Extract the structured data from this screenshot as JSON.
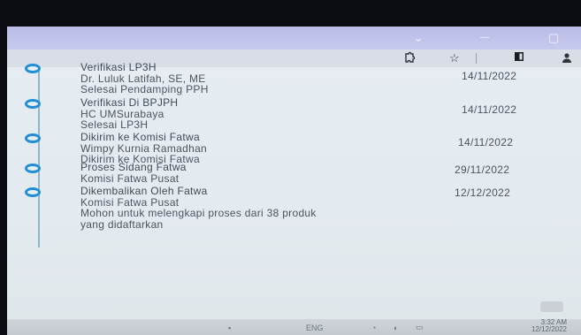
{
  "window": {
    "min_icon": "⌄",
    "dash_icon": "—",
    "restore_icon": "▢"
  },
  "toolbar": {
    "extension_icon": "puzzle-icon",
    "star_icon": "star-icon",
    "split_icon": "split-view-icon",
    "profile_icon": "profile-icon"
  },
  "timeline": [
    {
      "lines": [
        "Verifikasi LP3H",
        "Dr. Luluk Latifah, SE, ME",
        "Selesai Pendamping PPH"
      ],
      "date": "14/11/2022"
    },
    {
      "lines": [
        "Verifikasi Di BPJPH",
        "HC UMSurabaya",
        "Selesai LP3H"
      ],
      "date": "14/11/2022"
    },
    {
      "lines": [
        "Dikirim ke Komisi Fatwa",
        "Wimpy Kurnia Ramadhan",
        "Dikirim ke Komisi Fatwa"
      ],
      "date": "14/11/2022"
    },
    {
      "lines": [
        "Proses Sidang Fatwa",
        "Komisi Fatwa Pusat"
      ],
      "date": "29/11/2022"
    },
    {
      "lines": [
        "Dikembalikan Oleh Fatwa",
        "Komisi Fatwa Pusat",
        "Mohon untuk melengkapi proses dari 38 produk",
        "yang didaftarkan"
      ],
      "date": "12/12/2022"
    }
  ],
  "taskbar": {
    "lang": "ENG",
    "time": "3:32 AM",
    "date": "12/12/2022"
  },
  "colors": {
    "accent": "#1f8ed6",
    "titlebar": "#bfc3ea",
    "text": "#4a5560"
  }
}
